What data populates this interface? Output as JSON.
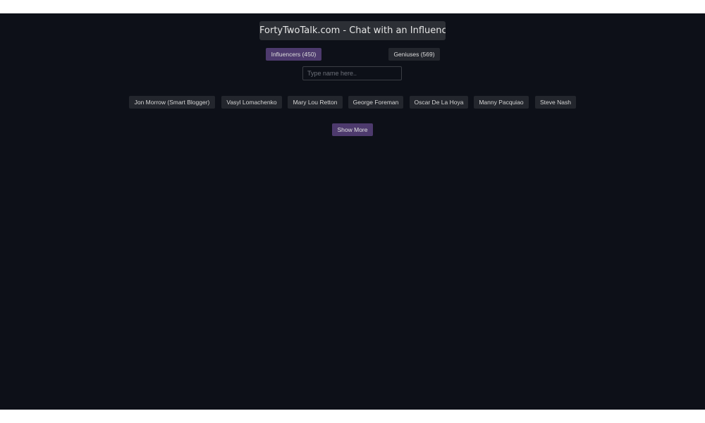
{
  "header": {
    "title": "FortyTwoTalk.com - Chat with an Influencer"
  },
  "tabs": [
    {
      "label": "Influencers (450)",
      "active": true
    },
    {
      "label": "Geniuses (569)",
      "active": false
    }
  ],
  "search": {
    "value": "",
    "placeholder": "Type name here.."
  },
  "people": [
    "Jon Morrow (Smart Blogger)",
    "Vasyl Lomachenko",
    "Mary Lou Retton",
    "George Foreman",
    "Oscar De La Hoya",
    "Manny Pacquiao",
    "Steve Nash"
  ],
  "show_more_label": "Show More",
  "colors": {
    "background": "#0d1018",
    "accent": "#4d3a6d",
    "button": "#23262d"
  }
}
